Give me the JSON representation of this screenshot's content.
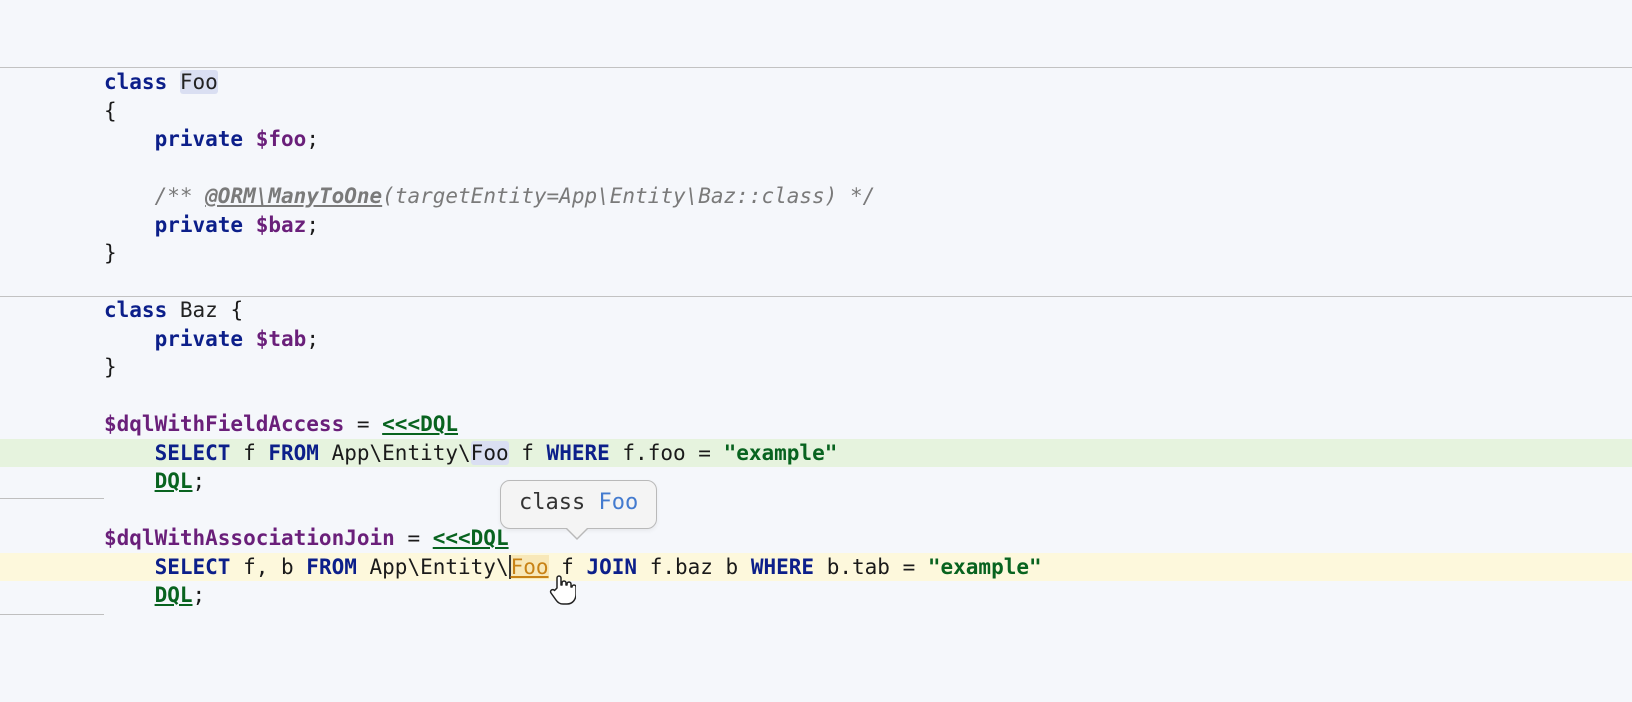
{
  "code": {
    "class_foo": {
      "kw_class": "class",
      "name": "Foo",
      "open": "{",
      "prop1_kw": "private",
      "prop1_var": "$foo",
      "prop1_semi": ";",
      "doc_open": "/** ",
      "doc_annot": "@ORM\\ManyToOne",
      "doc_rest": "(targetEntity=App\\Entity\\Baz::class) */",
      "prop2_kw": "private",
      "prop2_var": "$baz",
      "prop2_semi": ";",
      "close": "}"
    },
    "class_baz": {
      "kw_class": "class",
      "name": "Baz",
      "open": " {",
      "prop_kw": "private",
      "prop_var": "$tab",
      "prop_semi": ";",
      "close": "}"
    },
    "stmt1": {
      "var": "$dqlWithFieldAccess",
      "eq": " = ",
      "heredoc_open": "<<<DQL",
      "select": "SELECT",
      "select_args": " f ",
      "from_kw": "FROM",
      "entity_pre": " App\\Entity\\",
      "entity": "Foo",
      "alias": " f ",
      "where_kw": "WHERE",
      "where_expr": " f.foo = ",
      "string": "\"example\"",
      "heredoc_close": "DQL",
      "semi": ";"
    },
    "stmt2": {
      "var": "$dqlWithAssociationJoin",
      "eq": " = ",
      "heredoc_open": "<<<DQL",
      "select": "SELECT",
      "select_args": " f, b ",
      "from_kw": "FROM",
      "entity_pre": " App\\Entity\\",
      "entity": "Foo",
      "after_entity": " f ",
      "join_kw": "JOIN",
      "join_expr": " f.baz b ",
      "where_kw": "WHERE",
      "where_expr": " b.tab = ",
      "string": "\"example\"",
      "heredoc_close": "DQL",
      "semi": ";"
    }
  },
  "tooltip": {
    "kw_class": "class",
    "name": "Foo"
  }
}
